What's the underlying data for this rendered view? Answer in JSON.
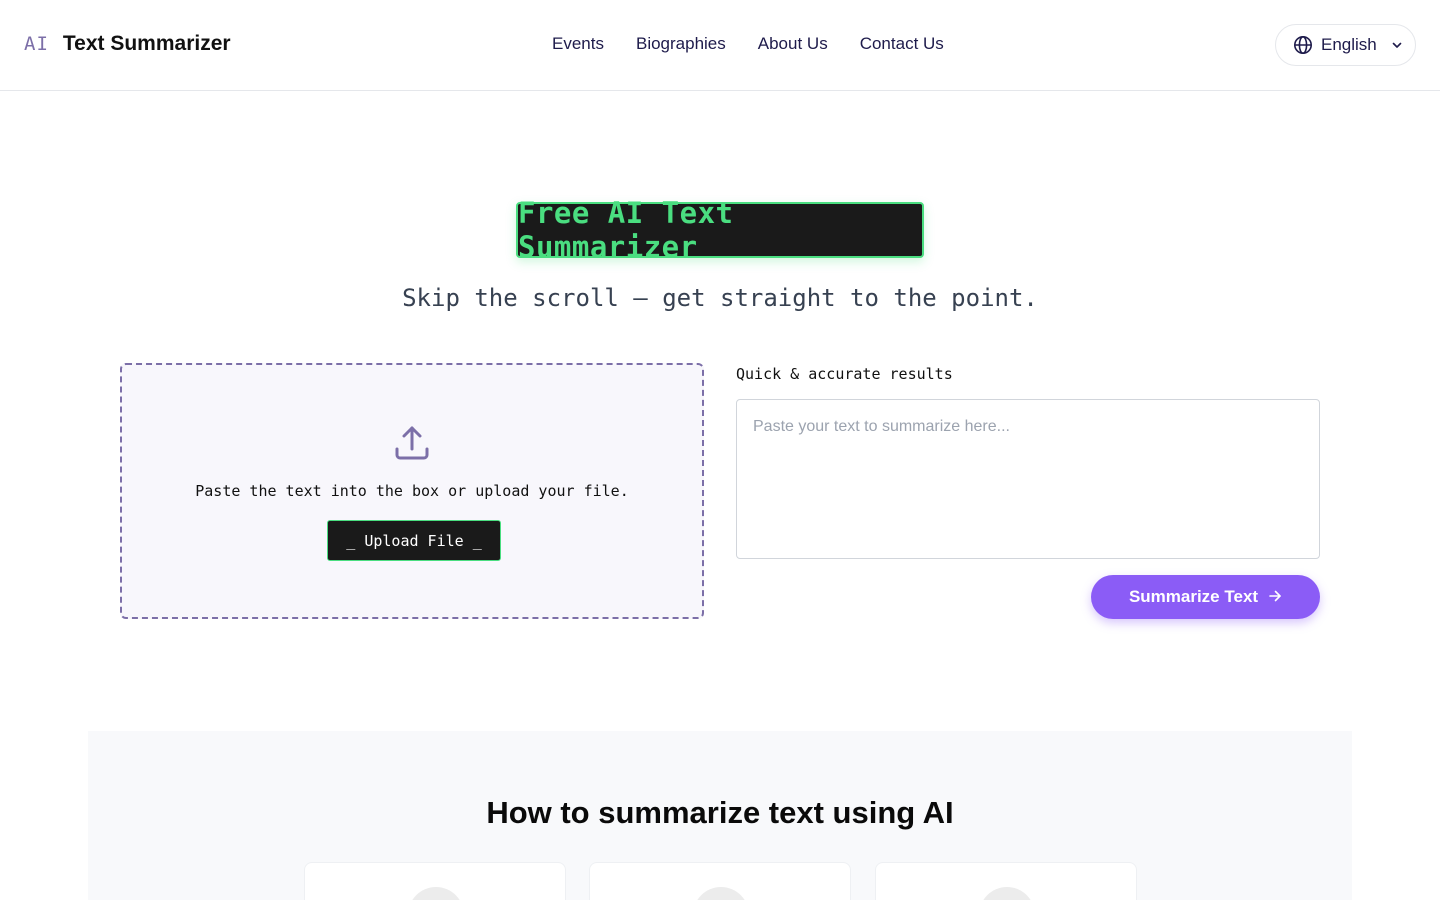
{
  "header": {
    "logo_mark": "AI",
    "logo_text": "Text Summarizer",
    "nav": [
      "Events",
      "Biographies",
      "About Us",
      "Contact Us"
    ],
    "language": "English",
    "language_icon": "globe-icon",
    "language_chevron": "chevron-down-icon"
  },
  "hero": {
    "title": "Free AI Text Summarizer",
    "subtitle": "Skip the scroll — get straight to the point."
  },
  "upload": {
    "icon": "upload-icon",
    "instruction": "Paste the text into the box or upload your file.",
    "button_label": "_ Upload File _"
  },
  "input": {
    "label": "Quick & accurate results",
    "placeholder": "Paste your text to summarize here...",
    "value": "",
    "submit_label": "Summarize Text",
    "submit_icon": "arrow-right-icon"
  },
  "howto": {
    "title": "How to summarize text using AI"
  },
  "colors": {
    "accent": "#8b5cf6",
    "terminal_green": "#4ade80",
    "terminal_bg": "#1a1a1a",
    "logo_purple": "#7c6fa8"
  }
}
